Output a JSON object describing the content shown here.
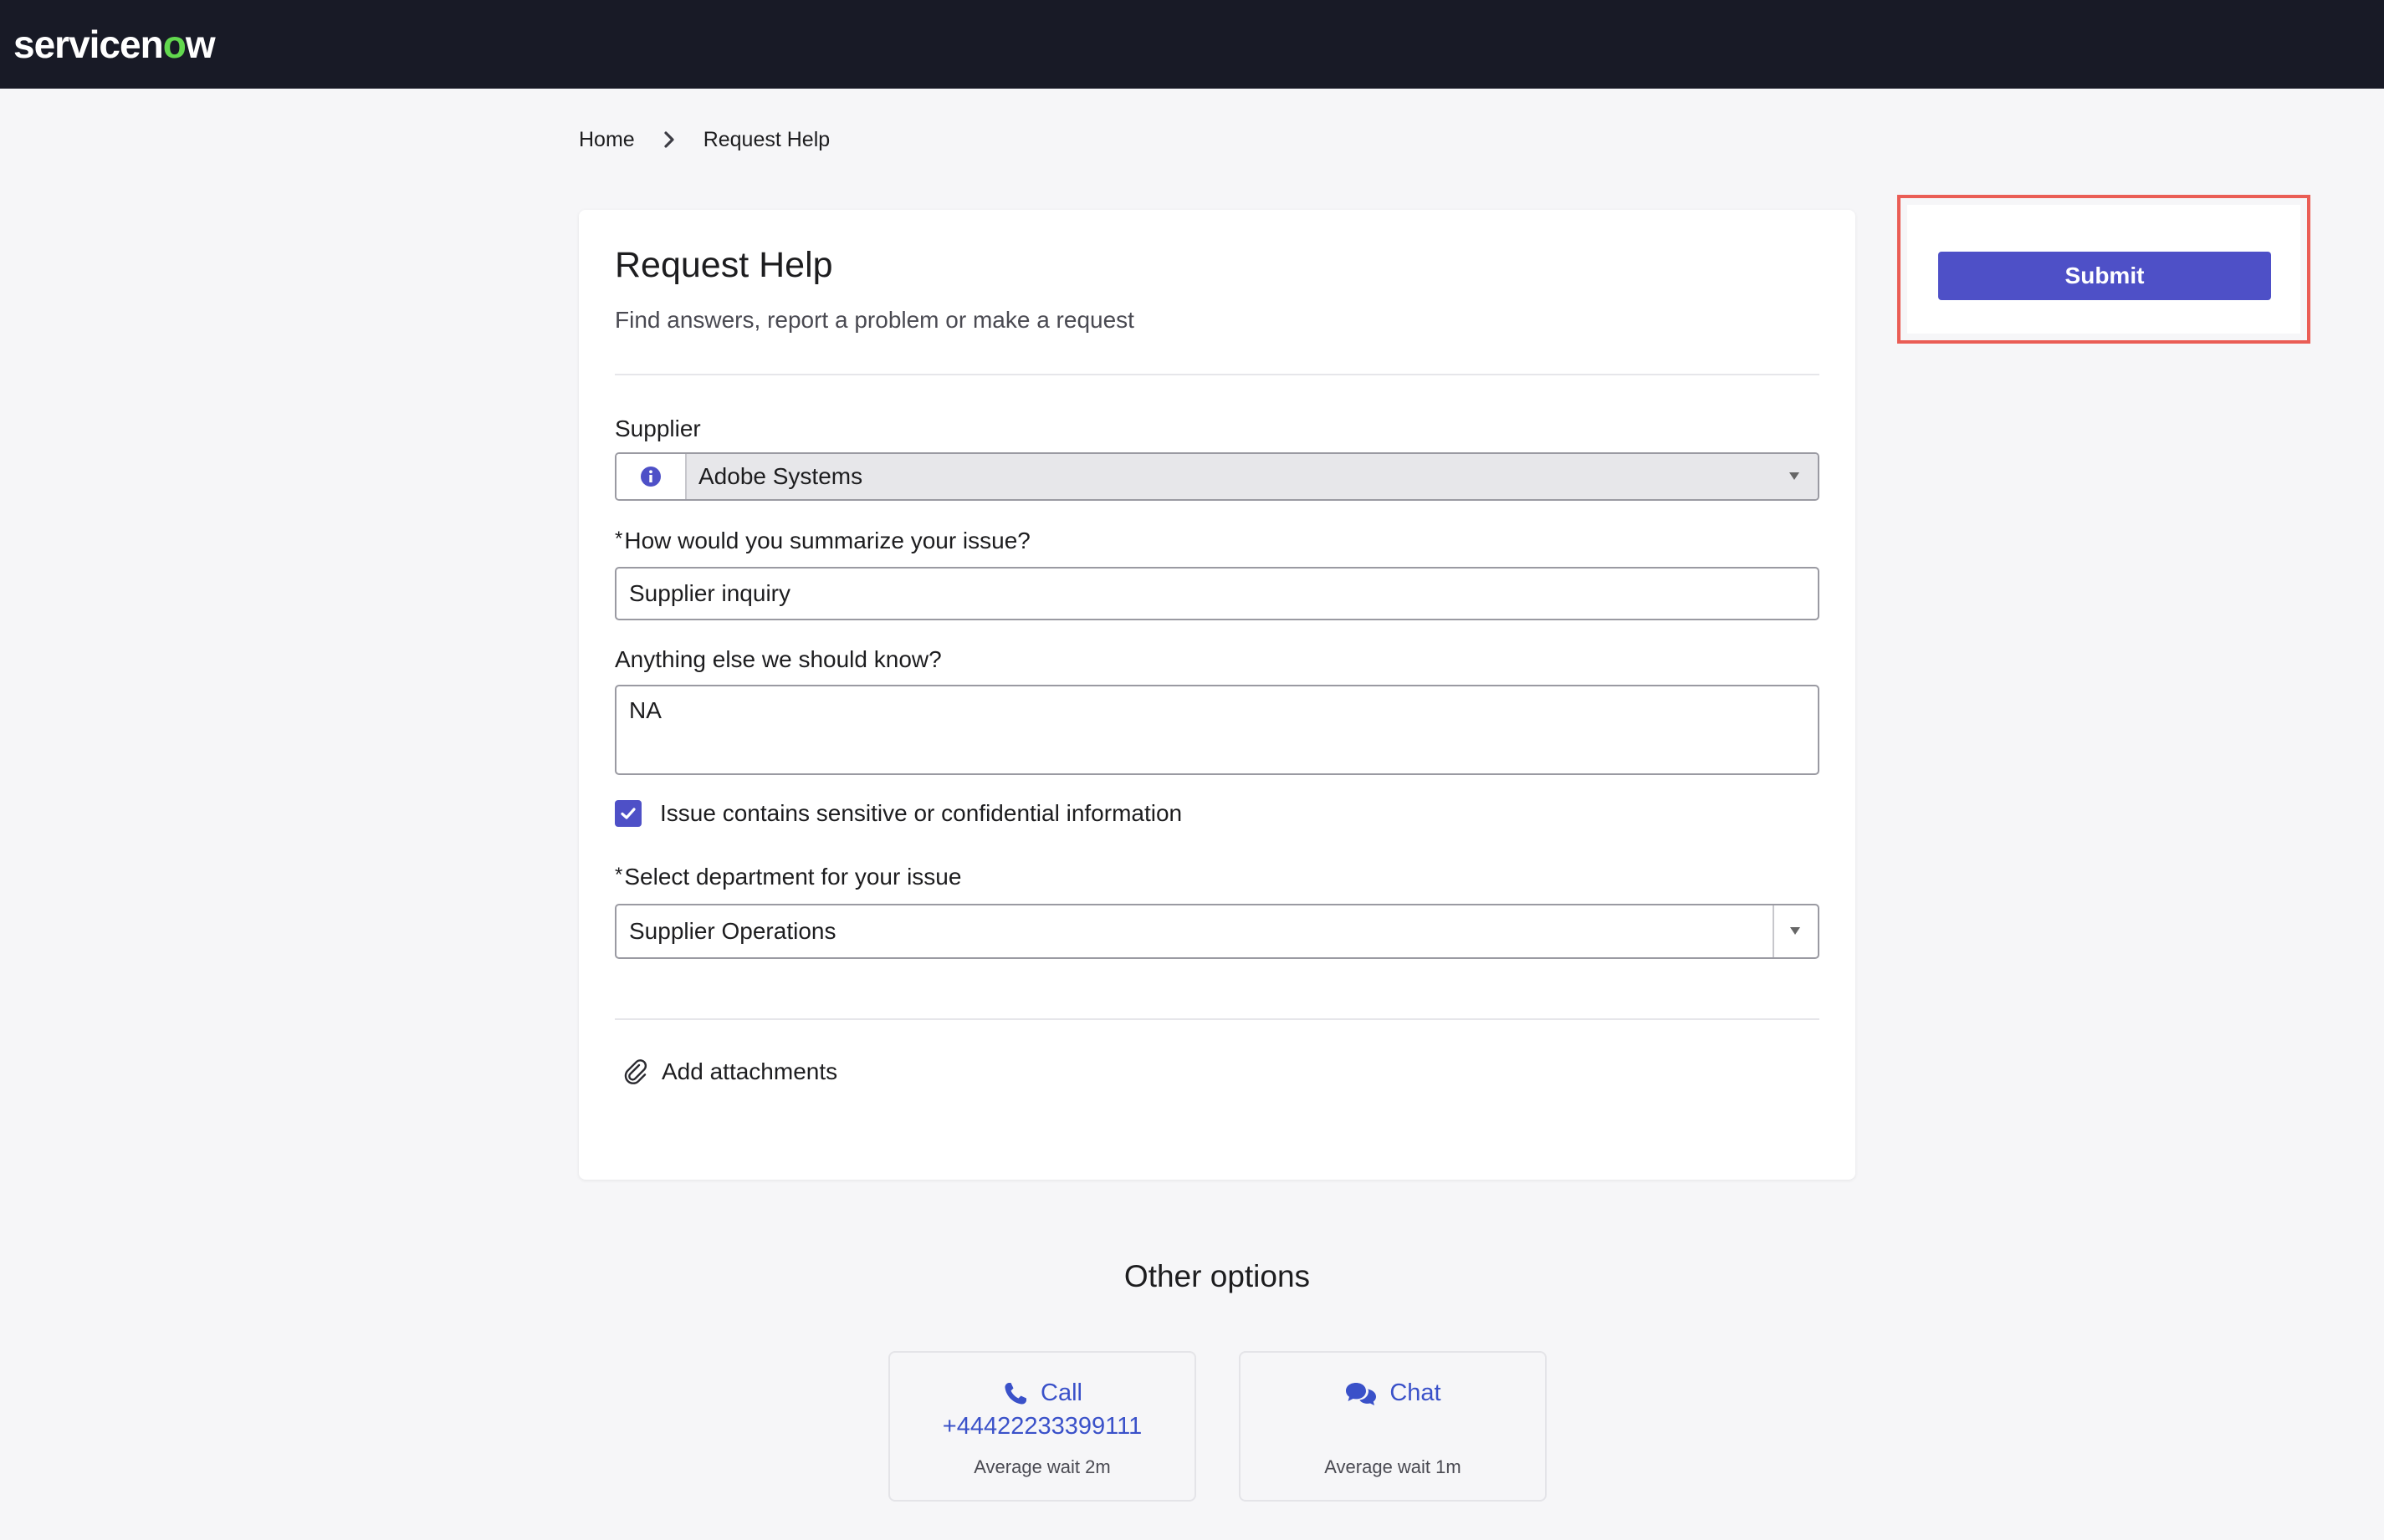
{
  "header": {
    "logo_text_a": "servicen",
    "logo_text_o": "o",
    "logo_text_b": "w"
  },
  "breadcrumb": {
    "home": "Home",
    "current": "Request Help"
  },
  "form": {
    "title": "Request Help",
    "subtitle": "Find answers, report a problem or make a request",
    "supplier_label": "Supplier",
    "supplier_value": "Adobe Systems",
    "summary_label": "How would you summarize your issue?",
    "summary_value": "Supplier inquiry",
    "details_label": "Anything else we should know?",
    "details_value": "NA",
    "sensitive_label": "Issue contains sensitive or confidential information",
    "sensitive_checked": true,
    "department_label": "Select department for your issue",
    "department_value": "Supplier Operations",
    "required_mark": "*",
    "attach_label": "Add attachments"
  },
  "actions": {
    "submit_label": "Submit"
  },
  "other_options": {
    "title": "Other options",
    "call": {
      "label": "Call",
      "phone": "+44422233399111",
      "wait": "Average wait 2m"
    },
    "chat": {
      "label": "Chat",
      "wait": "Average wait 1m"
    }
  },
  "colors": {
    "accent": "#4e50c7",
    "link": "#3a51c9",
    "topbar": "#181a26",
    "highlight": "#ea5d55"
  },
  "icons": [
    "chevron-right-icon",
    "info-icon",
    "caret-down-icon",
    "checkmark-icon",
    "paperclip-icon",
    "phone-icon",
    "chat-icon"
  ]
}
